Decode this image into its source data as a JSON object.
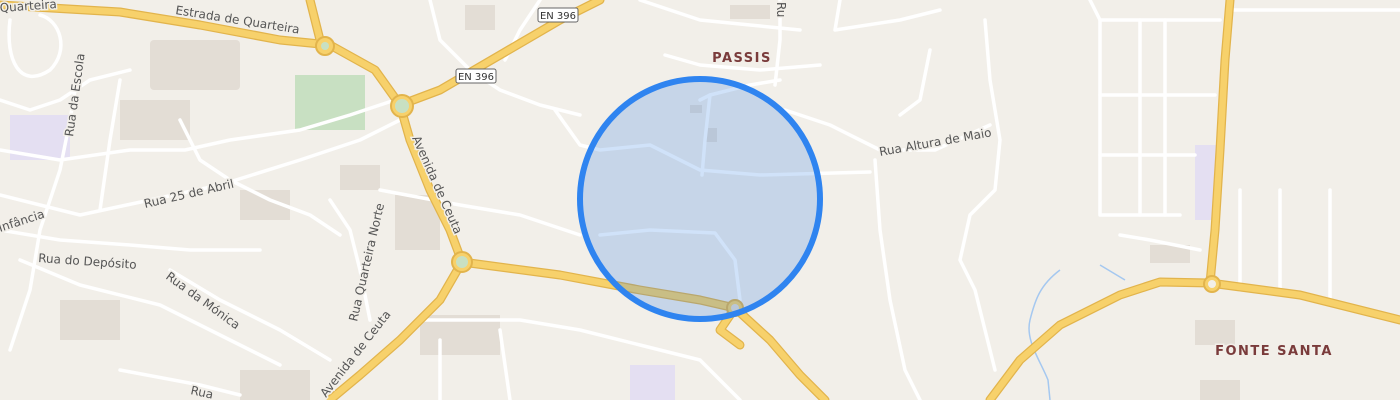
{
  "map": {
    "colors": {
      "land": "#f2efe9",
      "minor_road": "#ffffff",
      "major_road": "#f7d16b",
      "major_road_casing": "#e2b44c",
      "building": "#e3ddd5",
      "green": "#c8e0c2",
      "water": "#a5c8f0",
      "school": "#e4dff2",
      "radius_fill": "#2b7be4",
      "radius_stroke": "#2f84f0"
    },
    "places": [
      {
        "name": "PASSIS"
      },
      {
        "name": "FONTE SANTA"
      }
    ],
    "road_shields": [
      {
        "ref": "EN 396"
      },
      {
        "ref": "EN 396"
      }
    ],
    "street_labels": [
      {
        "name": "Estrada de Quarteira"
      },
      {
        "name": "Quarteira"
      },
      {
        "name": "Rua da Escola"
      },
      {
        "name": "Rua 25 de Abril"
      },
      {
        "name": "Infância"
      },
      {
        "name": "Rua do Depósito"
      },
      {
        "name": "Rua da Mónica"
      },
      {
        "name": "Rua Quarteira Norte"
      },
      {
        "name": "Avenida de Ceuta"
      },
      {
        "name": "Avenida de Ceuta"
      },
      {
        "name": "Rua Altura de Maio"
      },
      {
        "name": "Ru"
      },
      {
        "name": "Rua"
      }
    ],
    "location_marker": {
      "shape": "circle",
      "style": "accuracy radius"
    }
  }
}
